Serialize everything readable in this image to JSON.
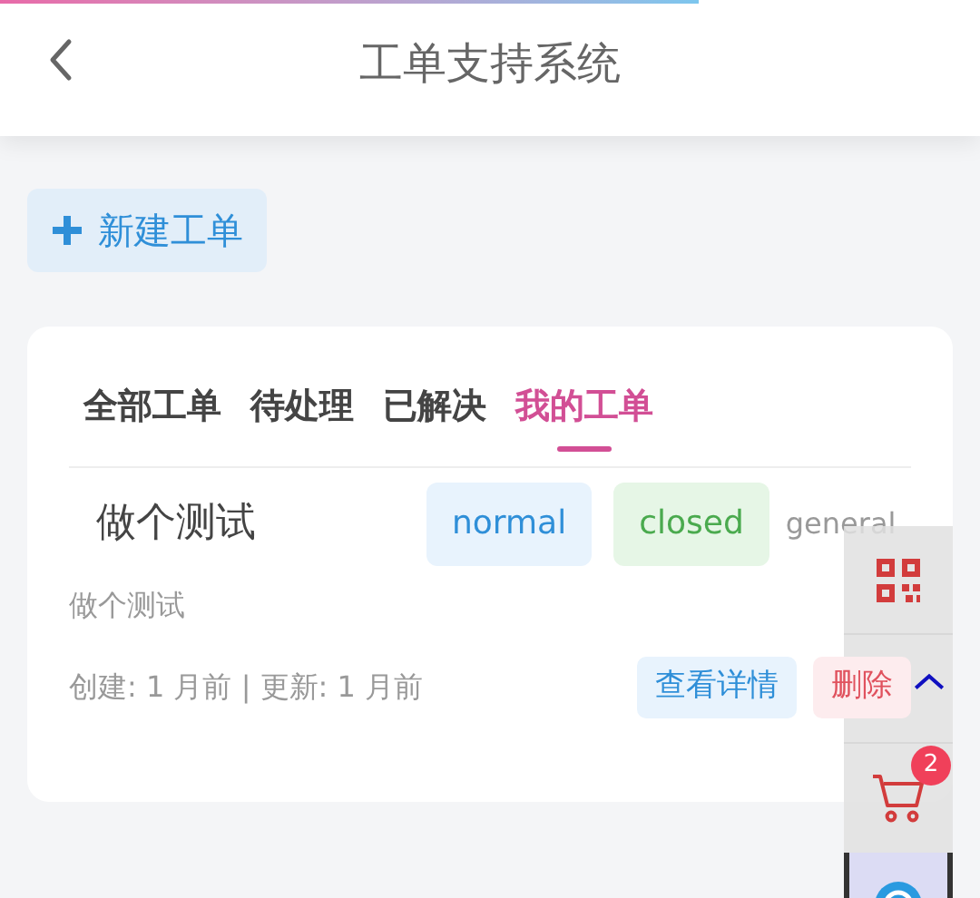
{
  "header": {
    "title": "工单支持系统"
  },
  "new_button": {
    "label": "新建工单"
  },
  "tabs": [
    {
      "label": "全部工单",
      "selected": false
    },
    {
      "label": "待处理",
      "selected": false
    },
    {
      "label": "已解决",
      "selected": false
    },
    {
      "label": "我的工单",
      "selected": true
    }
  ],
  "ticket": {
    "title": "做个测试",
    "tags": [
      {
        "text": "normal",
        "kind": "priority"
      },
      {
        "text": "closed",
        "kind": "status"
      }
    ],
    "category": "general",
    "description": "做个测试",
    "meta": "创建: 1 月前 | 更新: 1 月前",
    "actions": [
      {
        "label": "查看详情",
        "kind": "view"
      },
      {
        "label": "删除",
        "kind": "delete"
      }
    ]
  },
  "float_bar": {
    "cart_badge": "2"
  }
}
